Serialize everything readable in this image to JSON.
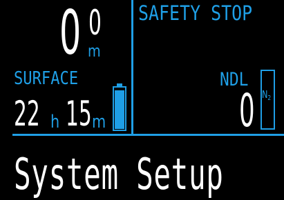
{
  "depth": {
    "whole": "0",
    "decimal": "0",
    "unit": "m"
  },
  "surface": {
    "label": "SURFACE",
    "hours": "22",
    "hours_unit": "h",
    "minutes": "15",
    "minutes_unit": "m"
  },
  "battery": {
    "icon": "battery-icon",
    "level": 0.95
  },
  "safety_stop": {
    "label": "SAFETY STOP"
  },
  "ndl": {
    "label": "NDL",
    "value": "0"
  },
  "n2_gauge": {
    "label": "N",
    "subscript": "2",
    "level": 0.0
  },
  "menu": {
    "title": "System Setup"
  },
  "colors": {
    "background": "#000000",
    "accent": "#1f9fe6",
    "primary_text": "#ffffff"
  }
}
